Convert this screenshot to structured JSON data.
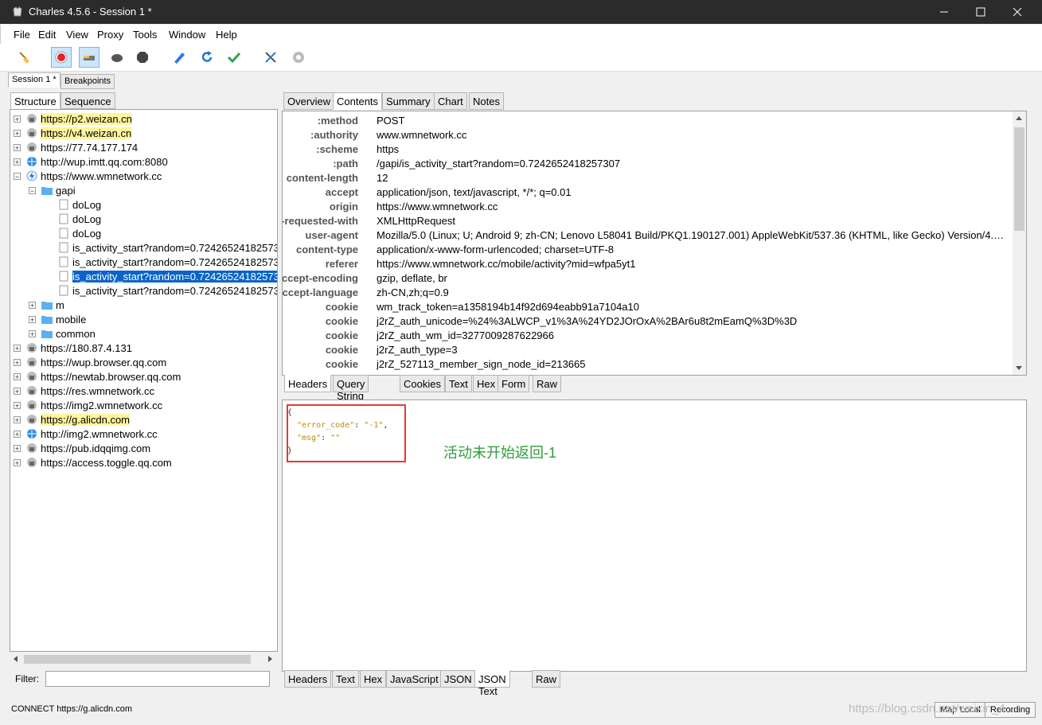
{
  "window": {
    "title": "Charles 4.5.6 - Session 1 *"
  },
  "menu": [
    "File",
    "Edit",
    "View",
    "Proxy",
    "Tools",
    "Window",
    "Help"
  ],
  "session_tabs": [
    "Session 1 *",
    "Breakpoints"
  ],
  "left_tabs": [
    "Structure",
    "Sequence"
  ],
  "tree": {
    "hosts_top": [
      {
        "label": "https://p2.weizan.cn",
        "highlight": true,
        "icon": "lock-icon"
      },
      {
        "label": "https://v4.weizan.cn",
        "highlight": true,
        "icon": "lock-icon"
      },
      {
        "label": "https://77.74.177.174",
        "highlight": false,
        "icon": "lock-icon"
      },
      {
        "label": "http://wup.imtt.qq.com:8080",
        "highlight": false,
        "icon": "globe-icon"
      },
      {
        "label": "https://www.wmnetwork.cc",
        "highlight": false,
        "icon": "lightning-icon"
      }
    ],
    "folder_gapi": "gapi",
    "gapi_children": [
      "doLog",
      "doLog",
      "doLog",
      "is_activity_start?random=0.724265241825730",
      "is_activity_start?random=0.724265241825730",
      "is_activity_start?random=0.724265241825730",
      "is_activity_start?random=0.724265241825730"
    ],
    "selected_index": 5,
    "folders": [
      "m",
      "mobile",
      "common"
    ],
    "hosts_bottom": [
      {
        "label": "https://180.87.4.131",
        "highlight": false,
        "icon": "lock-icon"
      },
      {
        "label": "https://wup.browser.qq.com",
        "highlight": false,
        "icon": "lock-icon"
      },
      {
        "label": "https://newtab.browser.qq.com",
        "highlight": false,
        "icon": "lock-icon"
      },
      {
        "label": "https://res.wmnetwork.cc",
        "highlight": false,
        "icon": "lock-icon"
      },
      {
        "label": "https://img2.wmnetwork.cc",
        "highlight": false,
        "icon": "lock-icon"
      },
      {
        "label": "https://g.alicdn.com",
        "highlight": true,
        "icon": "lock-icon"
      },
      {
        "label": "http://img2.wmnetwork.cc",
        "highlight": false,
        "icon": "globe-icon"
      },
      {
        "label": "https://pub.idqqimg.com",
        "highlight": false,
        "icon": "lock-icon"
      },
      {
        "label": "https://access.toggle.qq.com",
        "highlight": false,
        "icon": "lock-icon"
      }
    ]
  },
  "filter": {
    "label": "Filter:",
    "value": ""
  },
  "right_tabs": [
    "Overview",
    "Contents",
    "Summary",
    "Chart",
    "Notes"
  ],
  "request_headers": [
    {
      "k": ":method",
      "v": "POST"
    },
    {
      "k": ":authority",
      "v": "www.wmnetwork.cc"
    },
    {
      "k": ":scheme",
      "v": "https"
    },
    {
      "k": ":path",
      "v": "/gapi/is_activity_start?random=0.7242652418257307"
    },
    {
      "k": "content-length",
      "v": "12"
    },
    {
      "k": "accept",
      "v": "application/json, text/javascript, */*; q=0.01"
    },
    {
      "k": "origin",
      "v": "https://www.wmnetwork.cc"
    },
    {
      "k": "x-requested-with",
      "v": "XMLHttpRequest"
    },
    {
      "k": "user-agent",
      "v": "Mozilla/5.0 (Linux; U; Android 9; zh-CN; Lenovo L58041 Build/PKQ1.190127.001) AppleWebKit/537.36 (KHTML, like Gecko) Version/4.0 ..."
    },
    {
      "k": "content-type",
      "v": "application/x-www-form-urlencoded; charset=UTF-8"
    },
    {
      "k": "referer",
      "v": "https://www.wmnetwork.cc/mobile/activity?mid=wfpa5yt1"
    },
    {
      "k": "accept-encoding",
      "v": "gzip, deflate, br"
    },
    {
      "k": "accept-language",
      "v": "zh-CN,zh;q=0.9"
    },
    {
      "k": "cookie",
      "v": "wm_track_token=a1358194b14f92d694eabb91a7104a10"
    },
    {
      "k": "cookie",
      "v": "j2rZ_auth_unicode=%24%3ALWCP_v1%3A%24YD2JOrOxA%2BAr6u8t2mEamQ%3D%3D"
    },
    {
      "k": "cookie",
      "v": "j2rZ_auth_wm_id=3277009287622966"
    },
    {
      "k": "cookie",
      "v": "j2rZ_auth_type=3"
    },
    {
      "k": "cookie",
      "v": "j2rZ_527113_member_sign_node_id=213665"
    }
  ],
  "request_tabs": [
    "Headers",
    "Query String",
    "Cookies",
    "Text",
    "Hex",
    "Form",
    "Raw"
  ],
  "response": {
    "open": "{",
    "k1": "\"error_code\"",
    "v1": "\"-1\"",
    "k2": "\"msg\"",
    "v2": "\"\"",
    "close": "}",
    "annotation": "活动未开始返回-1"
  },
  "response_tabs": [
    "Headers",
    "Text",
    "Hex",
    "JavaScript",
    "JSON",
    "JSON Text",
    "Raw"
  ],
  "status": {
    "text": "CONNECT https://g.alicdn.com",
    "map_local": "Map Local",
    "recording": "Recording"
  },
  "watermark": "https://blog.csdn.net/weixin_4..."
}
